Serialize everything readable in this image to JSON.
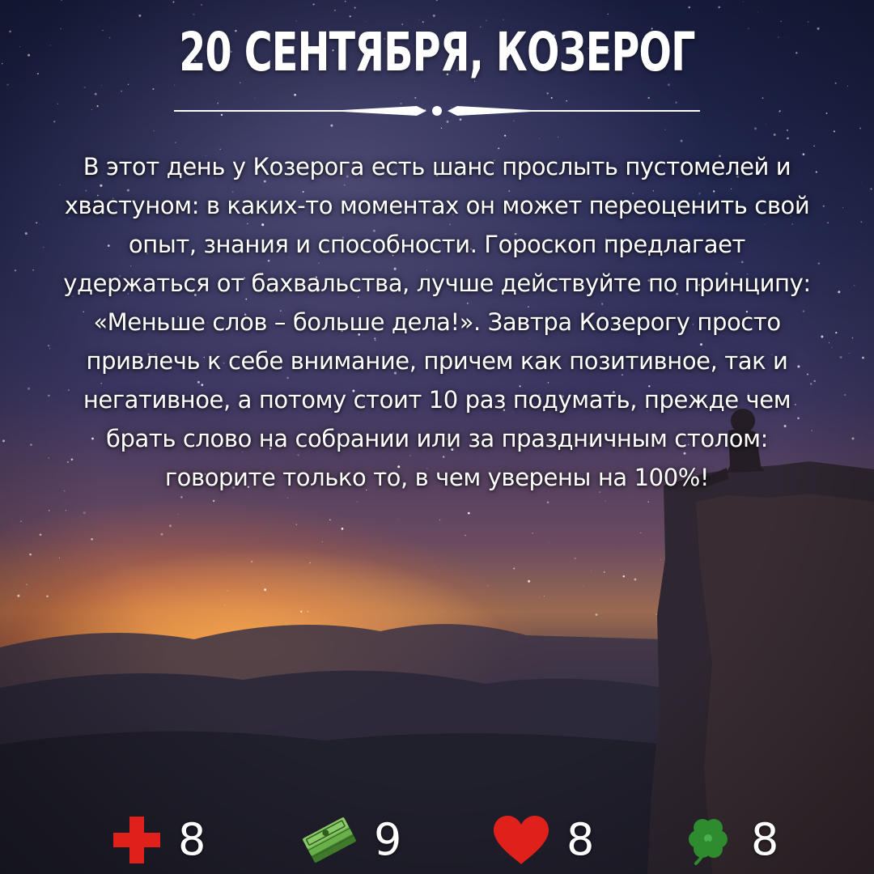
{
  "header": {
    "title": "20 СЕНТЯБРЯ, КОЗЕРОГ"
  },
  "horoscope": {
    "text": "В этот день у Козерога есть шанс прослыть пустомелей и хвастуном: в каких-то моментах он может переоценить свой опыт, знания и способности. Гороскоп предлагает удержаться от бахвальства, лучше действуйте по принципу: «Меньше слов – больше дела!». Завтра Козерогу просто привлечь к себе внимание, причем как позитивное, так и негативное, а потому стоит 10 раз подумать, прежде чем брать слово на собрании или за праздничным столом: говорите только то, в чем уверены на 100%!"
  },
  "ratings": [
    {
      "icon": "red-cross-icon",
      "value": "8",
      "color": "#e0201b"
    },
    {
      "icon": "money-stack-icon",
      "value": "9",
      "color": "#5d9a3a"
    },
    {
      "icon": "heart-icon",
      "value": "8",
      "color": "#e0201b"
    },
    {
      "icon": "clover-icon",
      "value": "8",
      "color": "#2e8b2e"
    }
  ],
  "colors": {
    "text": "#ffffff",
    "sky_top": "#1b2148",
    "horizon_glow": "#ffa03c"
  }
}
